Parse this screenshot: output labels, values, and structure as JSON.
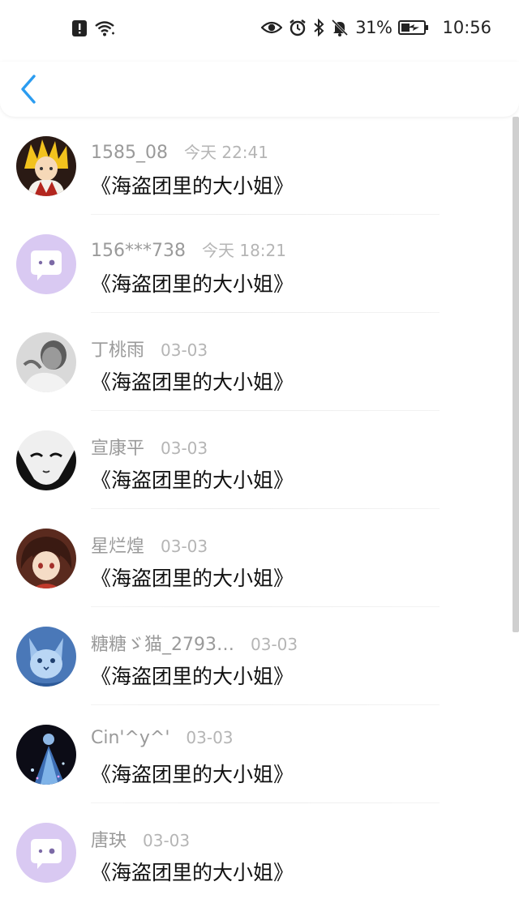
{
  "status_bar": {
    "battery": "31%",
    "clock": "10:56",
    "icons": [
      "alert-icon",
      "wifi-icon",
      "eye-icon",
      "alarm-icon",
      "bluetooth-icon",
      "mute-icon",
      "battery-icon"
    ]
  },
  "header": {
    "back_icon": "chevron-left-icon",
    "accent_color": "#2b9cf0"
  },
  "comments": [
    {
      "user": "1585_08",
      "time": "今天 22:41",
      "text": "《海盗团里的大小姐》",
      "avatar": "anime-blond-avatar"
    },
    {
      "user": "156***738",
      "time": "今天 18:21",
      "text": "《海盗团里的大小姐》",
      "avatar": "default-chat-avatar"
    },
    {
      "user": "丁桃雨",
      "time": "03-03",
      "text": "《海盗团里的大小姐》",
      "avatar": "grayscale-man-avatar"
    },
    {
      "user": "宣康平",
      "time": "03-03",
      "text": "《海盗团里的大小姐》",
      "avatar": "bw-face-avatar"
    },
    {
      "user": "星烂煌",
      "time": "03-03",
      "text": "《海盗团里的大小姐》",
      "avatar": "anime-girl-avatar"
    },
    {
      "user": "糖糖ゞ猫_2793…",
      "time": "03-03",
      "text": "《海盗团里的大小姐》",
      "avatar": "blue-cat-avatar"
    },
    {
      "user": "Cin'^y^'",
      "time": "03-03",
      "text": "《海盗团里的大小姐》",
      "avatar": "dark-figure-avatar"
    },
    {
      "user": "唐玦",
      "time": "03-03",
      "text": "《海盗团里的大小姐》",
      "avatar": "default-chat-avatar"
    }
  ]
}
